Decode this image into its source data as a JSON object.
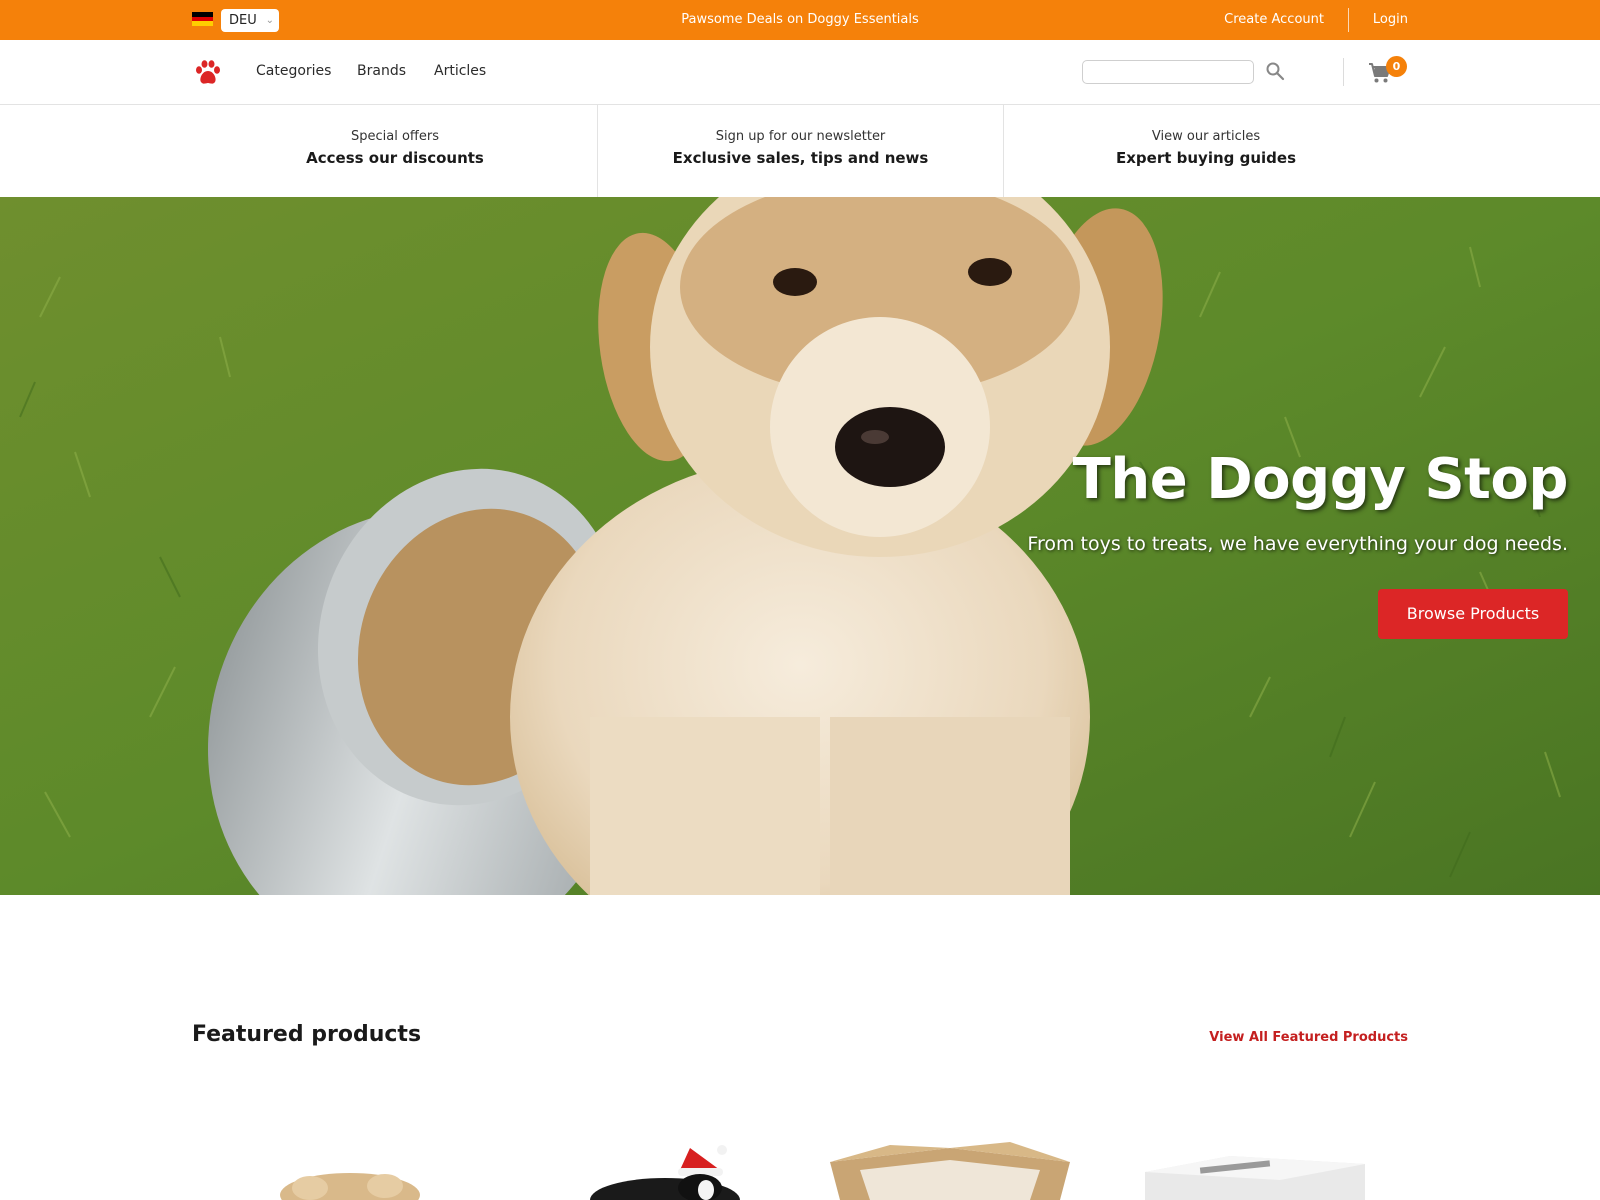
{
  "topbar": {
    "language": "DEU",
    "promo": "Pawsome Deals on Doggy Essentials",
    "create_account": "Create Account",
    "login": "Login",
    "color": "#f5810a"
  },
  "nav": {
    "links": [
      "Categories",
      "Brands",
      "Articles"
    ],
    "search_placeholder": "",
    "cart_count": "0"
  },
  "benefits": [
    {
      "small": "Special offers",
      "big": "Access our discounts"
    },
    {
      "small": "Sign up for our newsletter",
      "big": "Exclusive sales, tips and news"
    },
    {
      "small": "View our articles",
      "big": "Expert buying guides"
    }
  ],
  "hero": {
    "title": "The Doggy Stop",
    "subtitle": "From toys to treats, we have everything your dog needs.",
    "button": "Browse Products",
    "button_color": "#dc2626"
  },
  "featured": {
    "title": "Featured products",
    "view_all": "View All Featured Products"
  }
}
